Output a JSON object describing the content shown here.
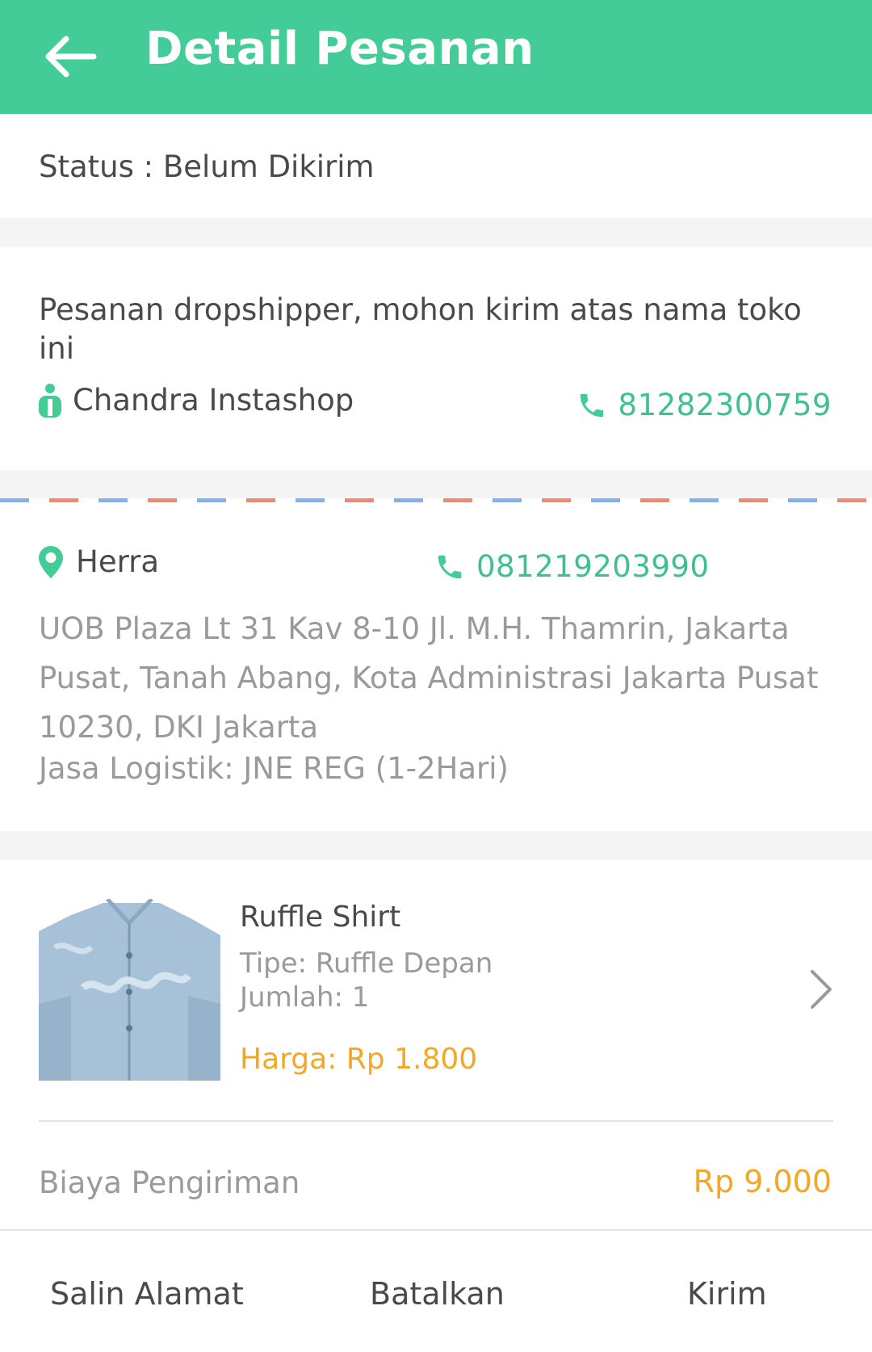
{
  "header": {
    "title": "Detail Pesanan",
    "back_icon": "arrow-left-icon"
  },
  "status": {
    "text": "Status : Belum Dikirim"
  },
  "dropship": {
    "note": "Pesanan dropshipper, mohon kirim atas nama toko ini",
    "shop_name": "Chandra Instashop",
    "shop_phone": "81282300759"
  },
  "shipping_address": {
    "recipient_name": "Herra",
    "recipient_phone": "081219203990",
    "address": "UOB Plaza Lt 31 Kav 8-10 Jl. M.H. Thamrin, Jakarta Pusat, Tanah Abang, Kota Administrasi Jakarta Pusat 10230, DKI Jakarta",
    "logistic": "Jasa Logistik: JNE REG (1-2Hari)"
  },
  "product": {
    "name": "Ruffle Shirt",
    "type": "Tipe: Ruffle Depan",
    "quantity": "Jumlah: 1",
    "price": "Harga: Rp 1.800"
  },
  "shipping_cost": {
    "label": "Biaya Pengiriman",
    "value": "Rp 9.000"
  },
  "actions": {
    "copy_address": "Salin Alamat",
    "cancel": "Batalkan",
    "send": "Kirim"
  },
  "colors": {
    "brand_green": "#44cc98",
    "phone_green": "#3fc08f",
    "price_orange": "#f5a623",
    "airmail_blue": "#7fb3f0",
    "airmail_red": "#f08a6e"
  }
}
